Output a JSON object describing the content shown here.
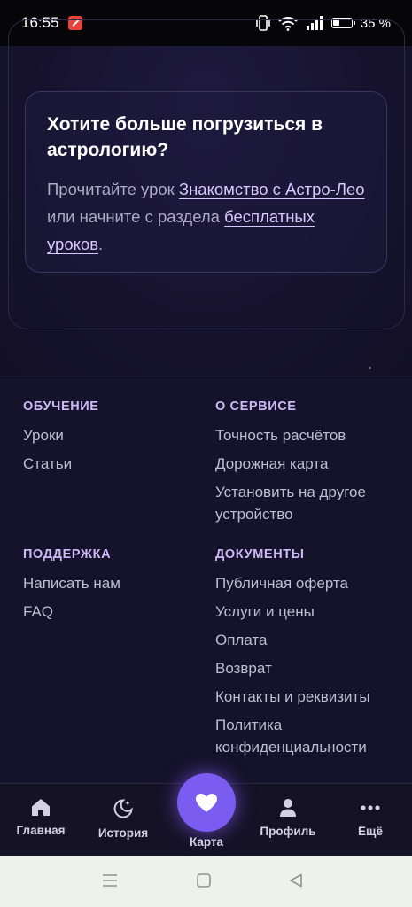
{
  "status_bar": {
    "time": "16:55",
    "battery_text": "35 %",
    "icons": [
      "vibrate-icon",
      "wifi-icon",
      "signal-icon",
      "battery-icon"
    ]
  },
  "info_card": {
    "title": "Хотите больше погрузиться в астрологию?",
    "text_1": "Прочитайте урок ",
    "link_1": "Знакомство с Астро-Лео",
    "text_2": " или начните с раздела ",
    "link_2": "бесплатных уроков",
    "text_3": "."
  },
  "footer": {
    "learning": {
      "heading": "ОБУЧЕНИЕ",
      "links": [
        "Уроки",
        "Статьи"
      ]
    },
    "service": {
      "heading": "О СЕРВИСЕ",
      "links": [
        "Точность расчётов",
        "Дорожная карта",
        "Установить на другое устройство"
      ]
    },
    "support": {
      "heading": "ПОДДЕРЖКА",
      "links": [
        "Написать нам",
        "FAQ"
      ]
    },
    "documents": {
      "heading": "ДОКУМЕНТЫ",
      "links": [
        "Публичная оферта",
        "Услуги и цены",
        "Оплата",
        "Возврат",
        "Контакты и реквизиты",
        "Политика конфиденциальности"
      ]
    }
  },
  "bottom_nav": {
    "items": [
      {
        "label": "Главная",
        "icon": "home-icon"
      },
      {
        "label": "История",
        "icon": "moon-icon"
      },
      {
        "label": "Карта",
        "icon": "heart-icon"
      },
      {
        "label": "Профиль",
        "icon": "user-icon"
      },
      {
        "label": "Ещё",
        "icon": "more-icon"
      }
    ]
  },
  "colors": {
    "accent": "#7b5cf0",
    "link": "#d9c8ff",
    "heading": "#cdb9f5",
    "background": "#15122b"
  }
}
